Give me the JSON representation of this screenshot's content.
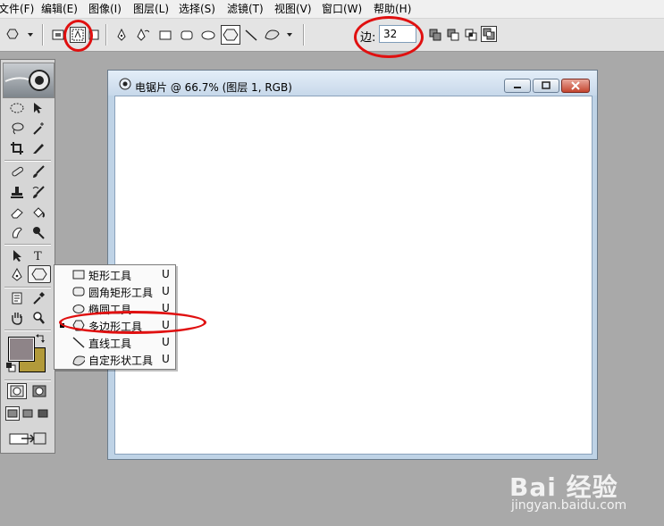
{
  "menubar": {
    "items": [
      "文件(F)",
      "编辑(E)",
      "图像(I)",
      "图层(L)",
      "选择(S)",
      "滤镜(T)",
      "视图(V)",
      "窗口(W)",
      "帮助(H)"
    ]
  },
  "options": {
    "sides_label": "边:",
    "sides_value": "32"
  },
  "document": {
    "title": "电锯片 @ 66.7% (图层 1, RGB)"
  },
  "flyout": {
    "items": [
      {
        "label": "矩形工具",
        "key": "U",
        "icon": "rectangle-icon"
      },
      {
        "label": "圆角矩形工具",
        "key": "U",
        "icon": "rounded-rectangle-icon"
      },
      {
        "label": "椭圆工具",
        "key": "U",
        "icon": "ellipse-icon"
      },
      {
        "label": "多边形工具",
        "key": "U",
        "icon": "polygon-icon",
        "selected": true
      },
      {
        "label": "直线工具",
        "key": "U",
        "icon": "line-icon"
      },
      {
        "label": "自定形状工具",
        "key": "U",
        "icon": "custom-shape-icon"
      }
    ]
  },
  "colors": {
    "foreground": "#8e8488",
    "background": "#b29a3a",
    "annotation": "#e01010"
  },
  "watermark": {
    "logo": "Bai 经验",
    "url": "jingyan.baidu.com"
  }
}
